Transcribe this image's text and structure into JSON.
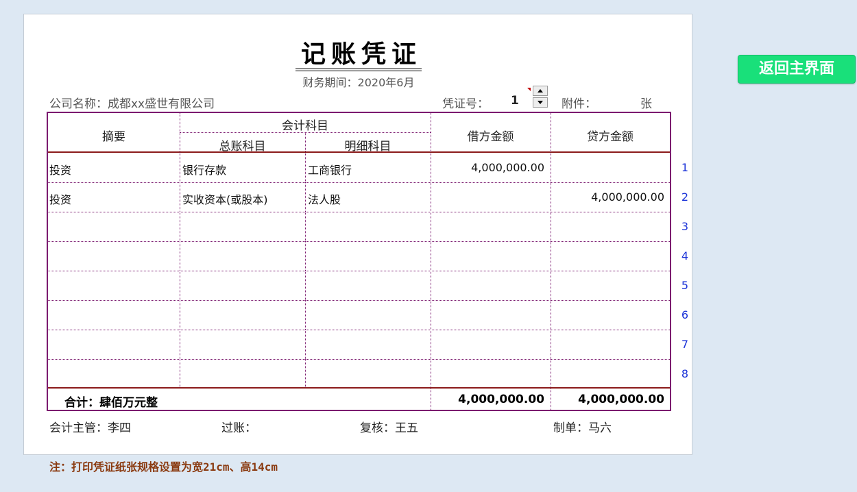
{
  "voucher": {
    "title": "记账凭证",
    "period_label": "财务期间：",
    "period_value": "2020年6月",
    "company_label": "公司名称：",
    "company_name": "成都xx盛世有限公司",
    "voucher_no_label": "凭证号：",
    "voucher_no": "1",
    "attachment_label": "附件：",
    "attachment_unit": "张"
  },
  "table": {
    "headers": {
      "summary": "摘要",
      "account": "会计科目",
      "general_account": "总账科目",
      "detail_account": "明细科目",
      "debit": "借方金额",
      "credit": "贷方金额"
    },
    "rows": [
      {
        "summary": "投资",
        "general": "银行存款",
        "detail": "工商银行",
        "debit": "4,000,000.00",
        "credit": ""
      },
      {
        "summary": "投资",
        "general": "实收资本(或股本)",
        "detail": "法人股",
        "debit": "",
        "credit": "4,000,000.00"
      },
      {
        "summary": "",
        "general": "",
        "detail": "",
        "debit": "",
        "credit": ""
      },
      {
        "summary": "",
        "general": "",
        "detail": "",
        "debit": "",
        "credit": ""
      },
      {
        "summary": "",
        "general": "",
        "detail": "",
        "debit": "",
        "credit": ""
      },
      {
        "summary": "",
        "general": "",
        "detail": "",
        "debit": "",
        "credit": ""
      },
      {
        "summary": "",
        "general": "",
        "detail": "",
        "debit": "",
        "credit": ""
      },
      {
        "summary": "",
        "general": "",
        "detail": "",
        "debit": "",
        "credit": ""
      }
    ],
    "line_numbers": [
      "1",
      "2",
      "3",
      "4",
      "5",
      "6",
      "7",
      "8"
    ],
    "total_label": "合计：肆佰万元整",
    "total_debit": "4,000,000.00",
    "total_credit": "4,000,000.00"
  },
  "signatures": {
    "supervisor": "会计主管：李四",
    "posting": "过账：",
    "review": "复核：王五",
    "preparer": "制单：马六"
  },
  "note": "注：打印凭证纸张规格设置为宽21cm、高14cm",
  "back_button_label": "返回主界面",
  "colors": {
    "background": "#dde8f3",
    "table_border": "#7b1a6f",
    "rule_red": "#8b1a1a",
    "line_number_blue": "#1a32d8",
    "note_brown": "#8a3a10",
    "button_green": "#19e07a"
  }
}
